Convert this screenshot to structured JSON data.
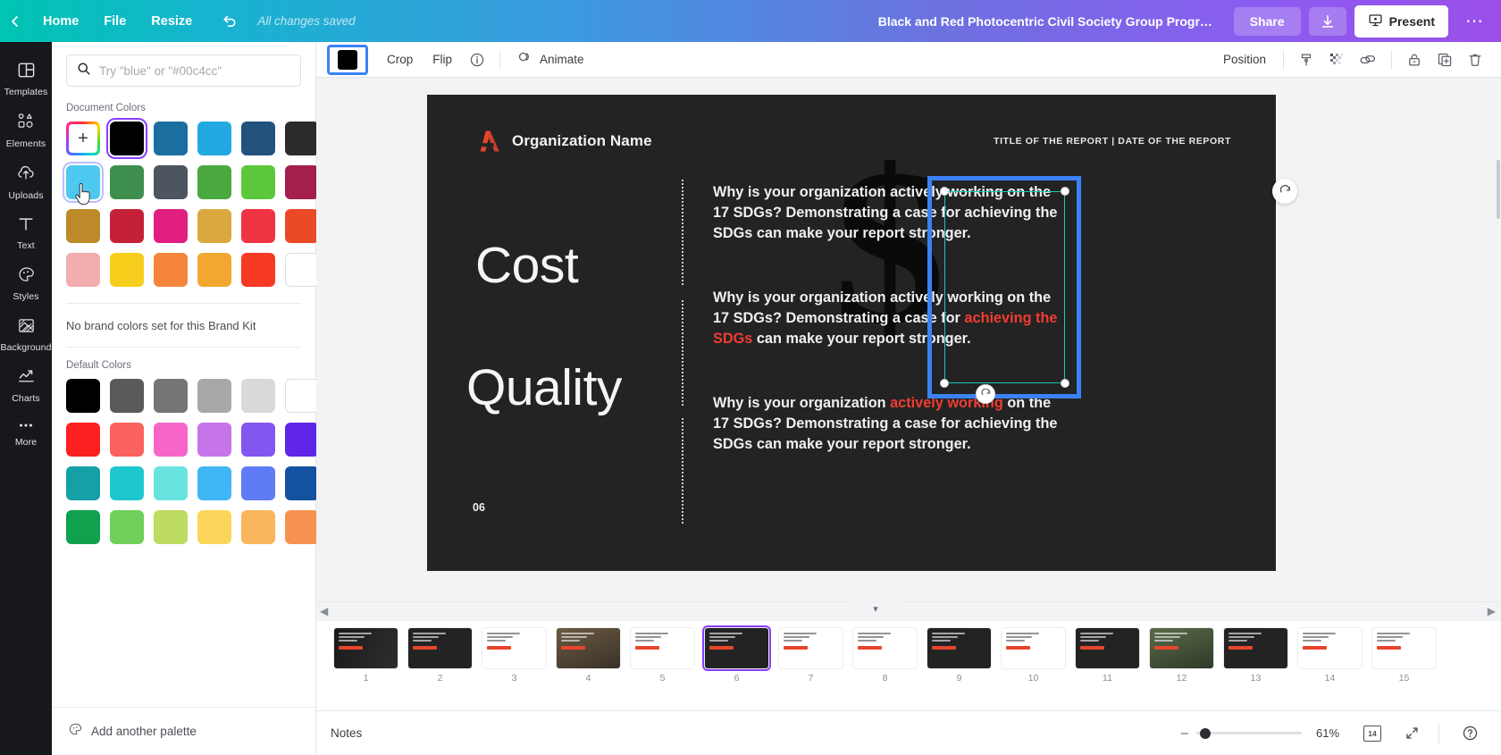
{
  "topbar": {
    "back_icon": "chevron-left-icon",
    "home_label": "Home",
    "file_label": "File",
    "resize_label": "Resize",
    "undo_icon": "undo-icon",
    "save_status": "All changes saved",
    "doc_title": "Black and Red Photocentric Civil Society Group Progress Re...",
    "share_label": "Share",
    "download_icon": "download-icon",
    "present_label": "Present",
    "present_icon": "present-icon",
    "more_icon": "ellipsis-icon"
  },
  "rail": {
    "items": [
      {
        "label": "Templates",
        "icon": "templates-icon"
      },
      {
        "label": "Elements",
        "icon": "elements-icon"
      },
      {
        "label": "Uploads",
        "icon": "uploads-icon"
      },
      {
        "label": "Text",
        "icon": "text-icon"
      },
      {
        "label": "Styles",
        "icon": "styles-icon"
      },
      {
        "label": "Background",
        "icon": "background-icon"
      },
      {
        "label": "Charts",
        "icon": "charts-icon"
      },
      {
        "label": "More",
        "icon": "more-icon"
      }
    ]
  },
  "panel": {
    "search_placeholder": "Try \"blue\" or \"#00c4cc\"",
    "search_value": "",
    "search_icon": "search-icon",
    "document_colors_label": "Document Colors",
    "document_colors": [
      "rainbow-add",
      "#000000",
      "#1b6ea0",
      "#23a9e2",
      "#22527c",
      "#2b2b2b",
      "#4dc9f0",
      "#3e8f4e",
      "#4d5560",
      "#4aa93f",
      "#5cc73a",
      "#a41f4e",
      "#bd8a2a",
      "#c42138",
      "#e01f7e",
      "#d9a93f",
      "#ef3343",
      "#ea4b26",
      "#f2aeae",
      "#f7ce1c",
      "#f5853a",
      "#f2a830",
      "#f63a24",
      "#ffffff"
    ],
    "document_selected_index": 1,
    "document_hover_index": 6,
    "no_brand_text": "No brand colors set for this Brand Kit",
    "default_colors_label": "Default Colors",
    "default_colors": [
      "#000000",
      "#5a5a5a",
      "#757575",
      "#a8a8a8",
      "#d9d9d9",
      "#ffffff",
      "#fc2020",
      "#f9625e",
      "#f765c8",
      "#c674ea",
      "#8257f0",
      "#5f25e8",
      "#14a0a6",
      "#1ec7cd",
      "#68e3e0",
      "#3fb7f5",
      "#5f7bf5",
      "#1352a0",
      "#10a14e",
      "#71cf5c",
      "#bedb62",
      "#fbd65b",
      "#f9b65c",
      "#f79152"
    ],
    "add_palette_label": "Add another palette",
    "add_palette_icon": "palette-icon"
  },
  "toolbar2": {
    "color_swatch": "#000000",
    "crop_label": "Crop",
    "flip_label": "Flip",
    "info_icon": "info-icon",
    "animate_label": "Animate",
    "animate_icon": "animate-icon",
    "position_label": "Position",
    "transparency_icon": "transparency-icon",
    "copy_style_icon": "copy-style-icon",
    "link_icon": "link-icon",
    "lock_icon": "lock-icon",
    "duplicate_icon": "duplicate-icon",
    "delete_icon": "trash-icon"
  },
  "slide": {
    "logo_icon": "organization-logo-icon",
    "org_name": "Organization Name",
    "header_right": "TITLE OF THE REPORT | DATE OF THE REPORT",
    "word_1": "Cost",
    "word_2": "Quality",
    "page_number": "06",
    "dollar_glyph": "$",
    "paragraphs": [
      {
        "segments": [
          {
            "text": "Why is your organization actively working on the 17 SDGs? Demonstrating a case for achieving the SDGs can make your report stronger.",
            "color": "white"
          }
        ]
      },
      {
        "segments": [
          {
            "text": "Why is your organization actively working on the 17 SDGs? Demonstrating a case for ",
            "color": "white"
          },
          {
            "text": "achieving the SDGs",
            "color": "red"
          },
          {
            "text": " can make your report stronger.",
            "color": "white"
          }
        ]
      },
      {
        "segments": [
          {
            "text": "Why is your organization ",
            "color": "white"
          },
          {
            "text": "actively working",
            "color": "red"
          },
          {
            "text": " on the 17 SDGs? Demonstrating a case for achieving the SDGs can make your report stronger.",
            "color": "white"
          }
        ]
      }
    ],
    "accent_red": "#f03c32",
    "background": "#232323",
    "refresh_icon": "refresh-icon",
    "rotate_icon": "rotate-icon"
  },
  "strip": {
    "collapse_icon": "chevron-down-icon",
    "scroll_left_icon": "chevron-left-icon",
    "scroll_right_icon": "chevron-right-icon",
    "active_page": 6,
    "thumbs": [
      {
        "num": "1"
      },
      {
        "num": "2"
      },
      {
        "num": "3"
      },
      {
        "num": "4"
      },
      {
        "num": "5"
      },
      {
        "num": "6"
      },
      {
        "num": "7"
      },
      {
        "num": "8"
      },
      {
        "num": "9"
      },
      {
        "num": "10"
      },
      {
        "num": "11"
      },
      {
        "num": "12"
      },
      {
        "num": "13"
      },
      {
        "num": "14"
      },
      {
        "num": "15"
      }
    ]
  },
  "bottombar": {
    "notes_label": "Notes",
    "notes_icon": "notes-icon",
    "zoom_minus": "–",
    "zoom_percent": "61%",
    "page_count": "14",
    "grid_icon": "grid-view-icon",
    "fullscreen_icon": "fullscreen-icon",
    "help_icon": "help-icon"
  }
}
